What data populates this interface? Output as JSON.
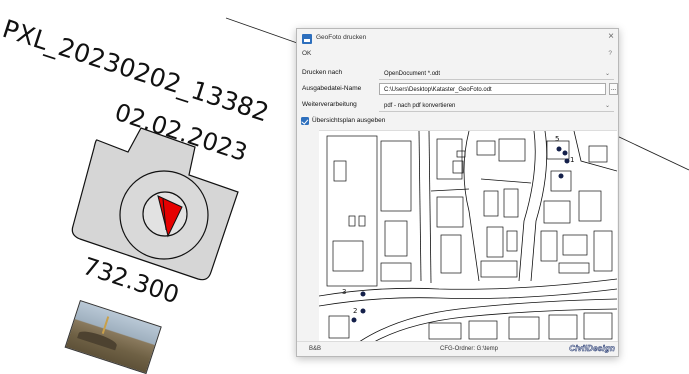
{
  "canvas": {
    "photo_name": "PXL_20230202_13382",
    "photo_date": "02.02.2023",
    "photo_height": "732.300"
  },
  "dialog": {
    "title": "GeoFoto drucken",
    "menu": {
      "ok": "OK",
      "help": "?"
    },
    "close_icon": "×",
    "fields": {
      "print_to": {
        "label": "Drucken nach",
        "value": "OpenDocument *.odt"
      },
      "output_name": {
        "label": "Ausgabedatei-Name",
        "value": "C:\\Users\\Desktop\\Kataster_GeoFoto.odt"
      },
      "post_processing": {
        "label": "Weiterverarbeitung",
        "value": "pdf - nach pdf konvertieren"
      }
    },
    "browse_label": "...",
    "overview_checkbox": {
      "label": "Übersichtsplan ausgeben",
      "checked": true
    },
    "map_markers": [
      "1",
      "2",
      "3",
      "5"
    ],
    "status": {
      "left": "B&B",
      "cfg": "CFG-Ordner: G:\\temp",
      "logo": "CivilDesign"
    }
  },
  "colors": {
    "accent": "#2d6fbd",
    "marker": "#14204a"
  }
}
